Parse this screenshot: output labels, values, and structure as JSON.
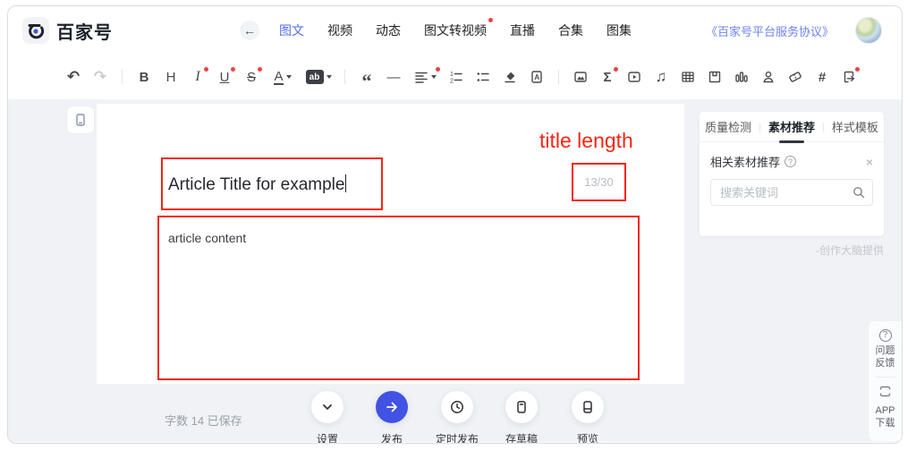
{
  "header": {
    "logo_text": "百家号",
    "back_glyph": "←",
    "nav": [
      {
        "label": "图文",
        "active": true,
        "badge": false
      },
      {
        "label": "视频",
        "active": false,
        "badge": false
      },
      {
        "label": "动态",
        "active": false,
        "badge": false
      },
      {
        "label": "图文转视频",
        "active": false,
        "badge": true
      },
      {
        "label": "直播",
        "active": false,
        "badge": false
      },
      {
        "label": "合集",
        "active": false,
        "badge": false
      },
      {
        "label": "图集",
        "active": false,
        "badge": false
      }
    ],
    "agreement_link": "《百家号平台服务协议》"
  },
  "toolbar": {
    "glyphs": {
      "undo": "↶",
      "redo": "↷",
      "bold": "B",
      "heading": "H",
      "italic": "I",
      "underline": "U",
      "strikethrough": "S",
      "font_color": "A",
      "highlight": "ab",
      "blockquote": "“",
      "horizontal_rule": "—",
      "formula": "Σ",
      "music": "♫",
      "topic_hash": "#"
    }
  },
  "editor": {
    "title_value": "Article Title for example",
    "title_counter": "13/30",
    "content_text": "article content"
  },
  "annotations": {
    "title_length_label": "title length",
    "box_color": "#f82413"
  },
  "side_panel": {
    "tabs": [
      {
        "label": "质量检测",
        "active": false
      },
      {
        "label": "素材推荐",
        "active": true
      },
      {
        "label": "样式模板",
        "active": false
      }
    ],
    "tab_divider": "|",
    "section_title": "相关素材推荐",
    "help_glyph": "?",
    "close_glyph": "×",
    "search_placeholder": "搜索关键词",
    "provider": "-创作大脑提供"
  },
  "footer": {
    "word_count": "字数 14 已保存",
    "actions": [
      {
        "label": "设置"
      },
      {
        "label": "发布",
        "primary": true
      },
      {
        "label": "定时发布"
      },
      {
        "label": "存草稿"
      },
      {
        "label": "预览"
      }
    ]
  },
  "floating": {
    "help_glyph": "?",
    "feedback_line1": "问题",
    "feedback_line2": "反馈",
    "app_line1": "APP",
    "app_line2": "下载"
  },
  "colors": {
    "accent_blue": "#4152e4",
    "nav_active_blue": "#4e6ef2",
    "link_blue": "#6b83f5",
    "annotation_red": "#f82413",
    "badge_red": "#f53f3f",
    "canvas_bg": "#ffffff",
    "page_bg": "#f0f2f5"
  }
}
